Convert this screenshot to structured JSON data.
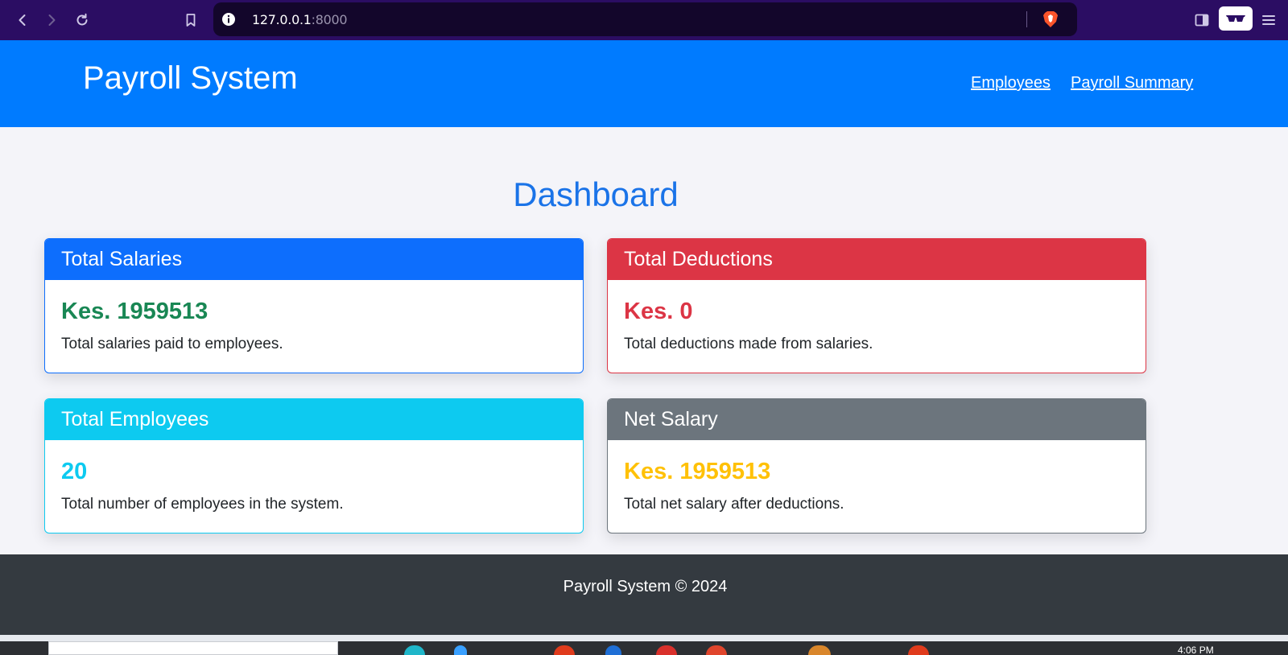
{
  "browser": {
    "url_host": "127.0.0.1",
    "url_port": ":8000"
  },
  "header": {
    "title": "Payroll System",
    "nav": {
      "employees": "Employees",
      "payroll_summary": "Payroll Summary"
    }
  },
  "dashboard": {
    "title": "Dashboard",
    "cards": [
      {
        "title": "Total Salaries",
        "value": "Kes. 1959513",
        "description": "Total salaries paid to employees.",
        "header_color": "#0d6efd",
        "value_color": "#198754"
      },
      {
        "title": "Total Deductions",
        "value": "Kes. 0",
        "description": "Total deductions made from salaries.",
        "header_color": "#dc3545",
        "value_color": "#dc3545"
      },
      {
        "title": "Total Employees",
        "value": "20",
        "description": "Total number of employees in the system.",
        "header_color": "#0dcaf0",
        "value_color": "#0dcaf0"
      },
      {
        "title": "Net Salary",
        "value": "Kes. 1959513",
        "description": "Total net salary after deductions.",
        "header_color": "#6c757d",
        "value_color": "#ffc107"
      }
    ]
  },
  "footer": {
    "text": "Payroll System © 2024"
  },
  "taskbar": {
    "time": "4:06 PM"
  },
  "icons": [
    "back-icon",
    "forward-icon",
    "reload-icon",
    "bookmark-icon",
    "info-icon",
    "brave-shield-icon",
    "sidebar-icon",
    "private-glasses-icon",
    "menu-icon"
  ]
}
